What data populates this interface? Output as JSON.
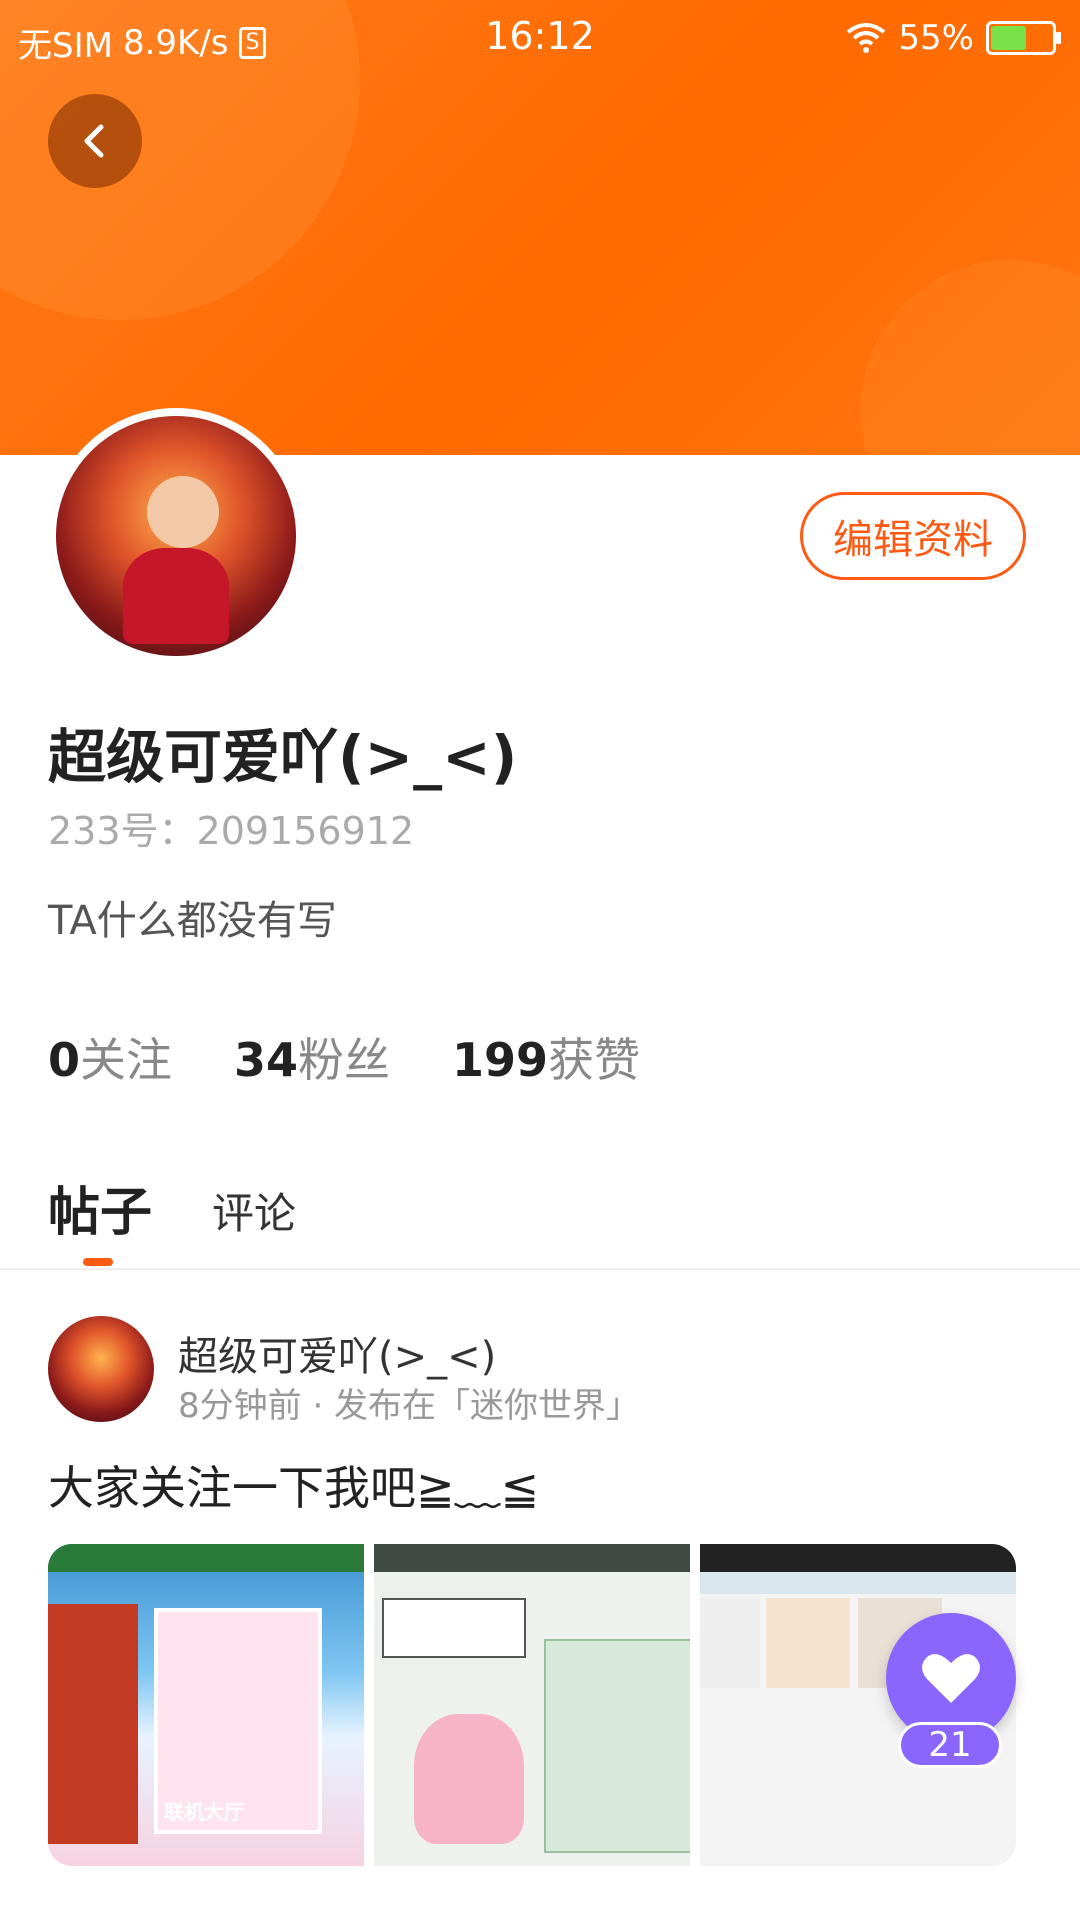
{
  "status_bar": {
    "carrier": "无SIM",
    "speed": "8.9K/s",
    "time": "16:12",
    "battery_percent": "55%"
  },
  "profile": {
    "name": "超级可爱吖(>_<)",
    "uid": "233号：209156912",
    "bio": "TA什么都没有写",
    "edit_label": "编辑资料"
  },
  "stats": [
    {
      "num": "0",
      "label": "关注"
    },
    {
      "num": "34",
      "label": "粉丝"
    },
    {
      "num": "199",
      "label": "获赞"
    }
  ],
  "tabs": [
    {
      "label": "帖子",
      "active": true
    },
    {
      "label": "评论",
      "active": false
    }
  ],
  "post": {
    "author": "超级可爱吖(>_<)",
    "meta": "8分钟前 · 发布在「迷你世界」",
    "text": "大家关注一下我吧≧﹏≦",
    "thumb1_caption": "联机大厅"
  },
  "like": {
    "count": "21"
  },
  "colors": {
    "header": "#ff6a00",
    "accent": "#ff5a14",
    "like": "#8a66ff"
  }
}
